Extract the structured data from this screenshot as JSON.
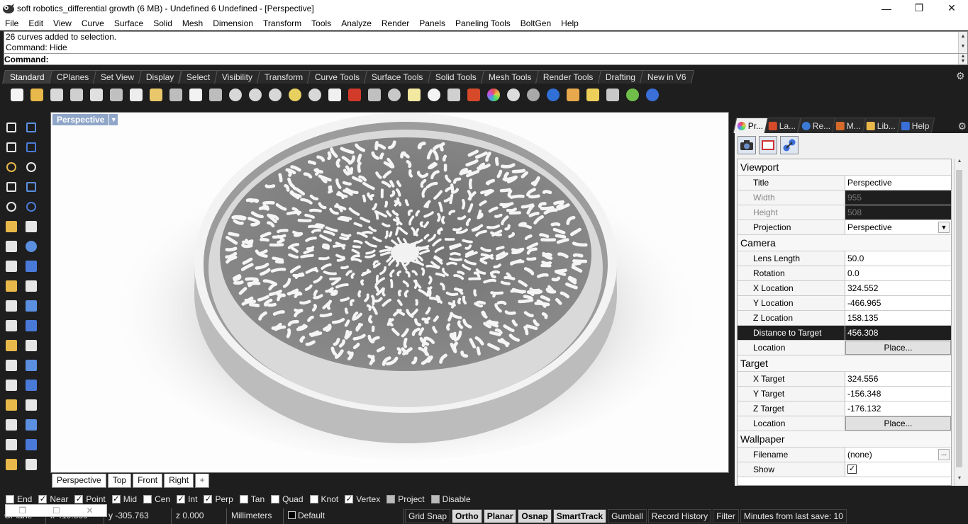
{
  "window": {
    "title": "soft robotics_differential growth (6 MB) - Undefined 6 Undefined - [Perspective]",
    "minimize": "—",
    "maximize": "❐",
    "close": "✕"
  },
  "menu": [
    "File",
    "Edit",
    "View",
    "Curve",
    "Surface",
    "Solid",
    "Mesh",
    "Dimension",
    "Transform",
    "Tools",
    "Analyze",
    "Render",
    "Panels",
    "Paneling Tools",
    "BoltGen",
    "Help"
  ],
  "command": {
    "history": [
      "26 curves added to selection.",
      "Command: Hide"
    ],
    "prompt": "Command:",
    "input_value": ""
  },
  "toolbar_tabs": [
    "Standard",
    "CPlanes",
    "Set View",
    "Display",
    "Select",
    "Visibility",
    "Transform",
    "Curve Tools",
    "Surface Tools",
    "Solid Tools",
    "Mesh Tools",
    "Render Tools",
    "Drafting",
    "New in V6"
  ],
  "toolbar_icons": [
    {
      "name": "new-icon",
      "color": "#f4f4f4"
    },
    {
      "name": "open-icon",
      "color": "#e8b84a"
    },
    {
      "name": "save-icon",
      "color": "#d9d9d9"
    },
    {
      "name": "print-icon",
      "color": "#cfcfcf"
    },
    {
      "name": "import-icon",
      "color": "#e0e0e0"
    },
    {
      "name": "cut-icon",
      "color": "#c0c0c0"
    },
    {
      "name": "copy-icon",
      "color": "#ededed"
    },
    {
      "name": "paste-icon",
      "color": "#e8c86a"
    },
    {
      "name": "undo-icon",
      "color": "#bdbdbd"
    },
    {
      "name": "pan-hand-icon",
      "color": "#f2f2f2"
    },
    {
      "name": "rotate-view-icon",
      "color": "#bdbdbd"
    },
    {
      "name": "zoom-icon",
      "color": "#d8d8d8"
    },
    {
      "name": "zoom-window-icon",
      "color": "#d8d8d8"
    },
    {
      "name": "zoom-extents-icon",
      "color": "#d8d8d8"
    },
    {
      "name": "zoom-selected-icon",
      "color": "#e8d060"
    },
    {
      "name": "zoom-target-icon",
      "color": "#d8d8d8"
    },
    {
      "name": "four-viewports-icon",
      "color": "#f0f0f0"
    },
    {
      "name": "car-icon",
      "color": "#d23a2a"
    },
    {
      "name": "point-icon",
      "color": "#c0c0c0"
    },
    {
      "name": "circle-target-icon",
      "color": "#c8c8c8"
    },
    {
      "name": "light-icon",
      "color": "#f2e8a0"
    },
    {
      "name": "bulb-icon",
      "color": "#f4f4f4"
    },
    {
      "name": "lock-icon",
      "color": "#d0d0d0"
    },
    {
      "name": "layers-icon",
      "color": "#d64a2a"
    },
    {
      "name": "color-wheel-icon",
      "color": "#e44d9a"
    },
    {
      "name": "sphere-shaded-icon",
      "color": "#dcdcdc"
    },
    {
      "name": "sphere-rendered-icon",
      "color": "#a9a9a9"
    },
    {
      "name": "sphere-blue-icon",
      "color": "#2f6fd6"
    },
    {
      "name": "material-icon",
      "color": "#e7a94c"
    },
    {
      "name": "settings-sun-icon",
      "color": "#eecf5a"
    },
    {
      "name": "crop-icon",
      "color": "#c8c8c8"
    },
    {
      "name": "plugin-icon",
      "color": "#6fbf4a"
    },
    {
      "name": "help-icon",
      "color": "#3a6fd8"
    }
  ],
  "toolbox": [
    [
      "select-arrow-icon",
      "point-dot-icon"
    ],
    [
      "polyline-icon",
      "curve-points-icon"
    ],
    [
      "circle-icon",
      "ellipse-icon"
    ],
    [
      "arc-icon",
      "rectangle-icon"
    ],
    [
      "polygon-icon",
      "fillet-curve-icon"
    ],
    [
      "surface-icon",
      "extrude-icon"
    ],
    [
      "box-solid-icon",
      "sphere-solid-icon"
    ],
    [
      "cylinder-icon",
      "mesh-icon"
    ],
    [
      "explode-icon",
      "boolean-icon"
    ],
    [
      "trim-icon",
      "split-icon"
    ],
    [
      "join-icon",
      "group-icon"
    ],
    [
      "offset-icon",
      "blend-icon"
    ],
    [
      "text-icon",
      "dimension-icon"
    ],
    [
      "array-icon",
      "edit-icon"
    ],
    [
      "block-icon",
      "grid-icon"
    ],
    [
      "points-grid-icon",
      "height-icon"
    ],
    [
      "analyze-icon",
      "check-icon"
    ],
    [
      "material-cube-icon",
      "paint-icon"
    ]
  ],
  "viewport": {
    "title": "Perspective",
    "tabs": [
      "Perspective",
      "Top",
      "Front",
      "Right"
    ],
    "add_tab": "+"
  },
  "panel": {
    "tabs": [
      {
        "label": "Pr...",
        "icon": "properties-icon",
        "color": "#d64a9a"
      },
      {
        "label": "La...",
        "icon": "layers-icon",
        "color": "#d64a2a"
      },
      {
        "label": "Re...",
        "icon": "render-icon",
        "color": "#3a7ad6"
      },
      {
        "label": "M...",
        "icon": "materials-icon",
        "color": "#d66a2a"
      },
      {
        "label": "Lib...",
        "icon": "libraries-icon",
        "color": "#e8b84a"
      },
      {
        "label": "Help",
        "icon": "help-book-icon",
        "color": "#3a6fd8"
      }
    ],
    "sections": {
      "viewport": "Viewport",
      "camera": "Camera",
      "target": "Target",
      "wallpaper": "Wallpaper"
    },
    "viewport_props": {
      "title_label": "Title",
      "title_value": "Perspective",
      "width_label": "Width",
      "width_value": "955",
      "height_label": "Height",
      "height_value": "508",
      "projection_label": "Projection",
      "projection_value": "Perspective"
    },
    "camera_props": {
      "lens_label": "Lens Length",
      "lens_value": "50.0",
      "rotation_label": "Rotation",
      "rotation_value": "0.0",
      "x_label": "X Location",
      "x_value": "324.552",
      "y_label": "Y Location",
      "y_value": "-466.965",
      "z_label": "Z Location",
      "z_value": "158.135",
      "dist_label": "Distance to Target",
      "dist_value": "456.308",
      "location_label": "Location",
      "location_button": "Place..."
    },
    "target_props": {
      "x_label": "X Target",
      "x_value": "324.556",
      "y_label": "Y Target",
      "y_value": "-156.348",
      "z_label": "Z Target",
      "z_value": "-176.132",
      "location_label": "Location",
      "location_button": "Place..."
    },
    "wallpaper_props": {
      "filename_label": "Filename",
      "filename_value": "(none)",
      "browse": "...",
      "show_label": "Show",
      "show_checked": "✓"
    }
  },
  "osnaps": [
    {
      "label": "End",
      "checked": ""
    },
    {
      "label": "Near",
      "checked": "✓"
    },
    {
      "label": "Point",
      "checked": "✓"
    },
    {
      "label": "Mid",
      "checked": "✓"
    },
    {
      "label": "Cen",
      "checked": ""
    },
    {
      "label": "Int",
      "checked": "✓"
    },
    {
      "label": "Perp",
      "checked": "✓"
    },
    {
      "label": "Tan",
      "checked": ""
    },
    {
      "label": "Quad",
      "checked": ""
    },
    {
      "label": "Knot",
      "checked": ""
    },
    {
      "label": "Vertex",
      "checked": "✓"
    },
    {
      "label": "Project",
      "checked": ""
    },
    {
      "label": "Disable",
      "checked": ""
    }
  ],
  "status": {
    "cplane": "CPlane",
    "x": "x 419.860",
    "y": "y -305.763",
    "z": "z 0.000",
    "units": "Millimeters",
    "layer": "Default",
    "grid_snap": "Grid Snap",
    "ortho": "Ortho",
    "planar": "Planar",
    "osnap": "Osnap",
    "smarttrack": "SmartTrack",
    "gumball": "Gumball",
    "record_history": "Record History",
    "filter": "Filter",
    "autosave": "Minutes from last save: 10"
  },
  "mini_window": {
    "restore": "❐",
    "maximize": "☐",
    "close": "✕"
  }
}
